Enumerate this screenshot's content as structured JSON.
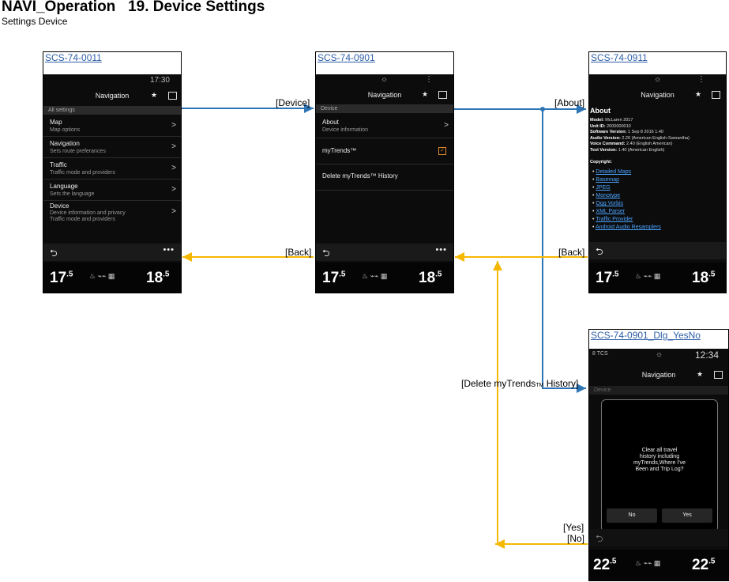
{
  "header": {
    "title": "NAVI_Operation   19. Device Settings",
    "subtitle": "Settings Device"
  },
  "colors": {
    "forward": "#2e75b6",
    "back": "#f5b800"
  },
  "screens": {
    "s0011": {
      "id": "SCS-74-0011",
      "time": "17:30",
      "nav_title": "Navigation",
      "section": "All settings",
      "rows": [
        {
          "label": "Map",
          "sub": "Map options"
        },
        {
          "label": "Navigation",
          "sub": "Sets route preferances"
        },
        {
          "label": "Traffic",
          "sub": "Traffic mode and providers"
        },
        {
          "label": "Language",
          "sub": "Sets the language"
        },
        {
          "label": "Device",
          "sub": "Device information and privacy",
          "sub2": "Traffic mode and providers"
        }
      ],
      "temp_left": "17",
      "temp_left_dec": ".5",
      "temp_right": "18",
      "temp_right_dec": ".5"
    },
    "s0901": {
      "id": "SCS-74-0901",
      "nav_title": "Navigation",
      "section": "Device",
      "rows": [
        {
          "label": "About",
          "sub": "Device information"
        },
        {
          "label": "myTrends™"
        },
        {
          "label": "Delete myTrends™ History"
        }
      ],
      "temp_left": "17",
      "temp_left_dec": ".5",
      "temp_right": "18",
      "temp_right_dec": ".5"
    },
    "s0911": {
      "id": "SCS-74-0911",
      "nav_title": "Navigation",
      "heading": "About",
      "info": [
        {
          "k": "Model:",
          "v": "McLaren 2017"
        },
        {
          "k": "Unit ID:",
          "v": "2000000010"
        },
        {
          "k": "Software Version:",
          "v": "1 Sep 8 2016 1.40"
        },
        {
          "k": "Audio Version:",
          "v": "2.20 (American English-Samantha)"
        },
        {
          "k": "Voice Command:",
          "v": "2.40 (English American)"
        },
        {
          "k": "Text Version:",
          "v": "1.40 (American English)"
        }
      ],
      "copyright": "Copyright:",
      "links": [
        "Detailed Maps",
        "Basemap",
        "JPEG",
        "Monotype",
        "Ogg Vorbis",
        "XML Parser",
        "Traffic Provider",
        "Android Audio Resamplers"
      ],
      "temp_left": "17",
      "temp_left_dec": ".5",
      "temp_right": "18",
      "temp_right_dec": ".5"
    },
    "sdlg": {
      "id": "SCS-74-0901_Dlg_YesNo",
      "time": "12:34",
      "status_left": "8 TCS",
      "nav_title": "Navigation",
      "section": "Device",
      "message": [
        "Clear all travel",
        "history including",
        "myTrends,Where I've",
        "Been and Trip Log?"
      ],
      "no": "No",
      "yes": "Yes",
      "temp_left": "22",
      "temp_left_dec": ".5",
      "temp_right": "22",
      "temp_right_dec": ".5"
    }
  },
  "transitions": {
    "device": "[Device]",
    "about": "[About]",
    "back1": "[Back]",
    "back2": "[Back]",
    "delete_pre": "[Delete myTrends",
    "delete_tm": "TM",
    "delete_post": " History]",
    "yes": "[Yes]",
    "no": "[No]"
  }
}
